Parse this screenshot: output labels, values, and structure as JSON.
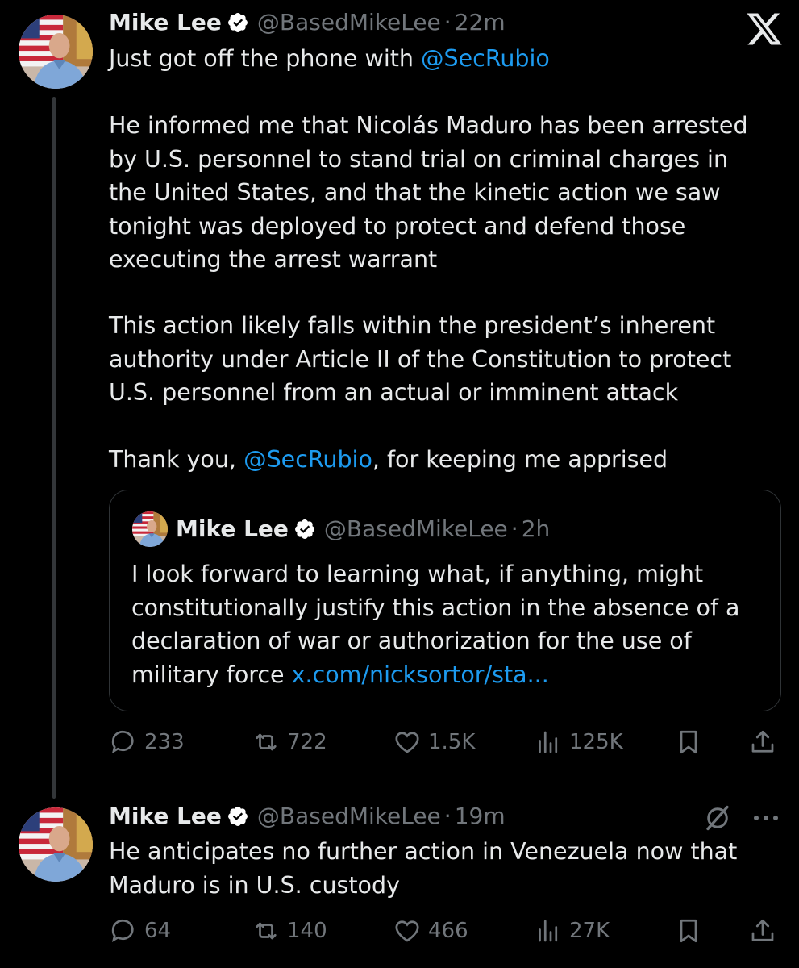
{
  "post": {
    "author_name": "Mike Lee",
    "handle": "@BasedMikeLee",
    "separator": "·",
    "time": "22m",
    "intro": "Just got off the phone with ",
    "mention1": "@SecRubio",
    "para1": "He informed me that Nicolás Maduro has been arrested\nby U.S. personnel to stand trial on criminal charges in\nthe United States, and that the kinetic action we saw\ntonight was deployed to protect and defend those\nexecuting the arrest warrant",
    "para2": "This action likely falls within the president’s inherent\nauthority under Article II of the Constitution to protect\nU.S. personnel from an actual or imminent attack",
    "thanks_prefix": "Thank you, ",
    "mention2": "@SecRubio",
    "thanks_suffix": ", for keeping me apprised",
    "quote": {
      "author_name": "Mike Lee",
      "handle": "@BasedMikeLee",
      "separator": "·",
      "time": "2h",
      "text": "I look forward to learning what, if anything, might\nconstitutionally justify this action in the absence of a\ndeclaration of war or authorization for the use of\nmilitary force ",
      "link": "x.com/nicksortor/sta..."
    },
    "metrics": {
      "replies": "233",
      "reposts": "722",
      "likes": "1.5K",
      "views": "125K"
    }
  },
  "reply": {
    "author_name": "Mike Lee",
    "handle": "@BasedMikeLee",
    "separator": "·",
    "time": "19m",
    "text": "He anticipates no further action in Venezuela now that\nMaduro is in U.S. custody",
    "metrics": {
      "replies": "64",
      "reposts": "140",
      "likes": "466",
      "views": "27K"
    }
  },
  "icons": {
    "logo": "x-logo-icon",
    "verified": "verified-badge-icon",
    "reply": "reply-bubble-icon",
    "repost": "repost-arrows-icon",
    "like": "heart-icon",
    "views": "bar-chart-icon",
    "bookmark": "bookmark-icon",
    "share": "share-upload-icon",
    "grok": "grok-slash-icon",
    "more": "more-dots-icon"
  },
  "colors": {
    "background": "#000000",
    "text": "#e7e9ea",
    "muted": "#71767b",
    "link": "#1d9bf0",
    "verified": "#ffffff",
    "border": "#2f3336"
  }
}
